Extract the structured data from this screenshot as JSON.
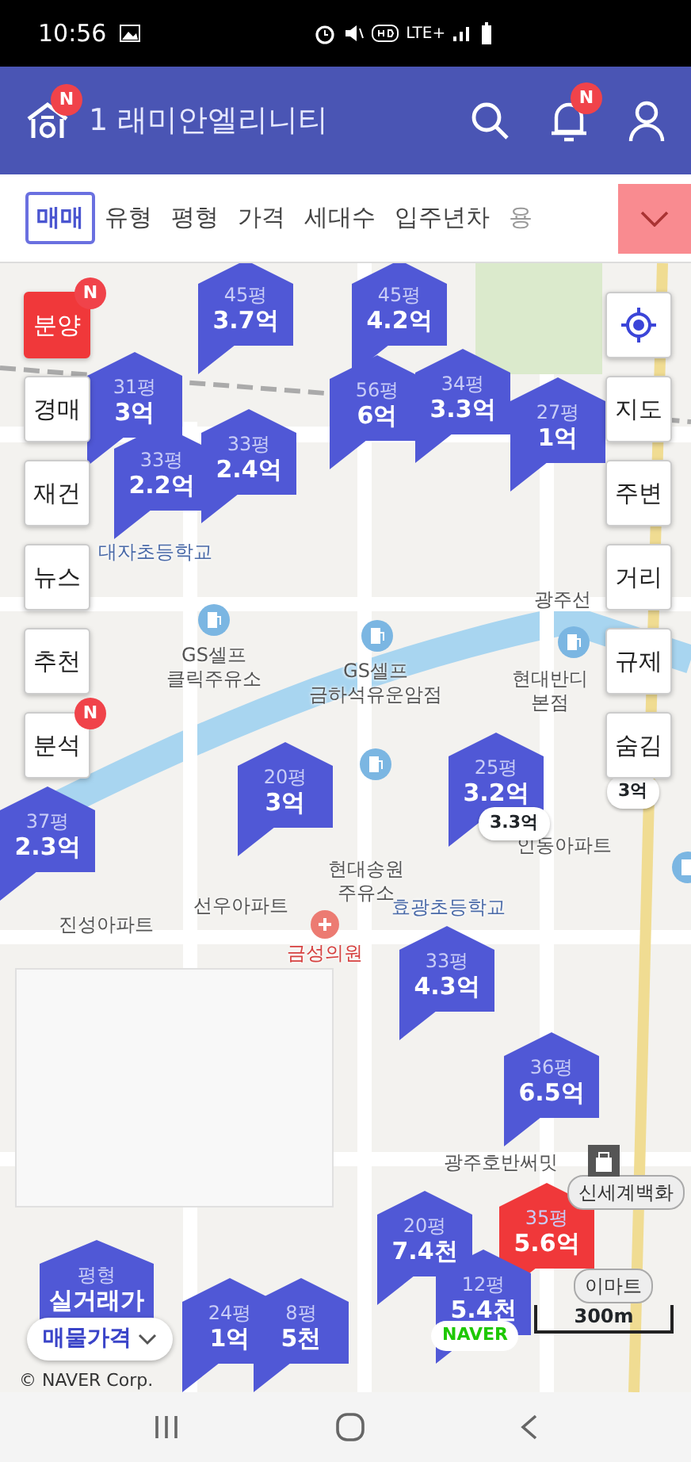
{
  "status_bar": {
    "time": "10:56",
    "network": "LTE+"
  },
  "header": {
    "home_badge": "N",
    "title": "1 래미안엘리니티",
    "bell_badge": "N"
  },
  "filter_tabs": [
    {
      "label": "매매",
      "selected": true,
      "faded": false
    },
    {
      "label": "유형",
      "selected": false,
      "faded": false
    },
    {
      "label": "평형",
      "selected": false,
      "faded": false
    },
    {
      "label": "가격",
      "selected": false,
      "faded": false
    },
    {
      "label": "세대수",
      "selected": false,
      "faded": false
    },
    {
      "label": "입주년차",
      "selected": false,
      "faded": false
    },
    {
      "label": "용",
      "selected": false,
      "faded": true
    }
  ],
  "left_buttons": [
    {
      "label": "분양",
      "kind": "highlight",
      "badge": "N"
    },
    {
      "label": "경매",
      "kind": "plain"
    },
    {
      "label": "재건",
      "kind": "plain"
    },
    {
      "label": "뉴스",
      "kind": "plain"
    },
    {
      "label": "추천",
      "kind": "plain"
    },
    {
      "label": "분석",
      "kind": "plain",
      "badge": "N"
    }
  ],
  "right_buttons": [
    {
      "kind": "locate"
    },
    {
      "label": "지도",
      "kind": "text"
    },
    {
      "label": "주변",
      "kind": "text"
    },
    {
      "label": "거리",
      "kind": "text"
    },
    {
      "label": "규제",
      "kind": "text"
    },
    {
      "label": "숨김",
      "kind": "text"
    }
  ],
  "map_labels": [
    {
      "text": "대자초등학교",
      "kind": "school"
    },
    {
      "text": "광주선",
      "kind": "road"
    },
    {
      "text": "GS셀프\n클릭주유소",
      "kind": "place"
    },
    {
      "text": "GS셀프\n금하석유운암점",
      "kind": "place"
    },
    {
      "text": "현대반디\n본점",
      "kind": "place"
    },
    {
      "text": "현대송원\n주유소",
      "kind": "place"
    },
    {
      "text": "인동아파트",
      "kind": "place"
    },
    {
      "text": "선우아파트",
      "kind": "place"
    },
    {
      "text": "진성아파트",
      "kind": "place"
    },
    {
      "text": "금성의원",
      "kind": "hospital"
    },
    {
      "text": "효광초등학교",
      "kind": "school"
    },
    {
      "text": "광주호반써밋",
      "kind": "place"
    }
  ],
  "price_markers": [
    {
      "area": "45평",
      "price": "3.7억",
      "color": "#5058d6"
    },
    {
      "area": "45평",
      "price": "4.2억",
      "color": "#5058d6"
    },
    {
      "area": "31평",
      "price": "3억",
      "color": "#5058d6"
    },
    {
      "area": "33평",
      "price": "2.2억",
      "color": "#5058d6"
    },
    {
      "area": "33평",
      "price": "2.4억",
      "color": "#5058d6"
    },
    {
      "area": "56평",
      "price": "6억",
      "color": "#5058d6"
    },
    {
      "area": "34평",
      "price": "3.3억",
      "color": "#5058d6"
    },
    {
      "area": "27평",
      "price": "1억",
      "color": "#5058d6"
    },
    {
      "area": "20평",
      "price": "3억",
      "color": "#5058d6"
    },
    {
      "area": "37평",
      "price": "2.3억",
      "color": "#5058d6"
    },
    {
      "area": "25평",
      "price": "3.2억",
      "color": "#5058d6"
    },
    {
      "area": "33평",
      "price": "4.3억",
      "color": "#5058d6"
    },
    {
      "area": "36평",
      "price": "6.5억",
      "color": "#5058d6"
    },
    {
      "area": "20평",
      "price": "7.4천",
      "color": "#5058d6"
    },
    {
      "area": "35평",
      "price": "5.6억",
      "color": "#f0383a"
    },
    {
      "area": "12평",
      "price": "5.4천",
      "color": "#5058d6"
    },
    {
      "area": "24평",
      "price": "1억",
      "color": "#5058d6"
    },
    {
      "area": "8평",
      "price": "5천",
      "color": "#5058d6"
    }
  ],
  "price_bubbles": [
    "3.3억",
    "3억"
  ],
  "store_pills": [
    "신세계백화",
    "이마트"
  ],
  "legend": {
    "area": "평형",
    "price": "실거래가",
    "dropdown": "매물가격"
  },
  "copyright": "© NAVER Corp.",
  "naver_logo": "NAVER",
  "scale": "300m"
}
